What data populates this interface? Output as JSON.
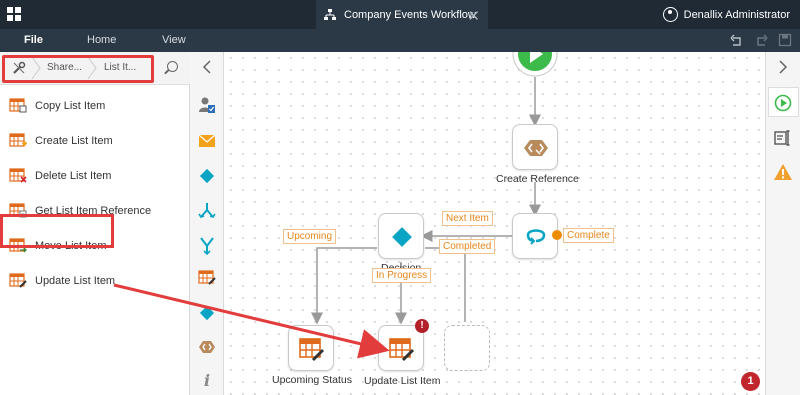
{
  "titlebar": {
    "tab_title": "Company Events Workflow",
    "close_glyph": "✕",
    "user_name": "Denallix Administrator"
  },
  "menu": {
    "file": "File",
    "home": "Home",
    "view": "View"
  },
  "breadcrumb": {
    "items": [
      "Share...",
      "List It..."
    ]
  },
  "list_items": [
    {
      "label": "Copy List Item",
      "icon": "copy-list-item-icon"
    },
    {
      "label": "Create List Item",
      "icon": "create-list-item-icon"
    },
    {
      "label": "Delete List Item",
      "icon": "delete-list-item-icon"
    },
    {
      "label": "Get List Item Reference",
      "icon": "get-list-item-reference-icon"
    },
    {
      "label": "Move List Item",
      "icon": "move-list-item-icon"
    },
    {
      "label": "Update List Item",
      "icon": "update-list-item-icon"
    }
  ],
  "workflow": {
    "nodes": {
      "create_reference": "Create Reference",
      "decision": "Decision",
      "upcoming_status": "Upcoming Status",
      "update_list_item": "Update List Item"
    },
    "outcomes": {
      "next_item": "Next Item",
      "complete": "Complete",
      "completed": "Completed",
      "upcoming": "Upcoming",
      "in_progress": "In Progress"
    },
    "error_glyph": "!"
  },
  "notification_count": "1",
  "colors": {
    "accent_orange": "#e8861a",
    "accent_teal": "#0aa5c4",
    "green_start": "#3dbb4a",
    "annotation_red": "#e23c3c",
    "dark_header": "#1f2a35"
  }
}
